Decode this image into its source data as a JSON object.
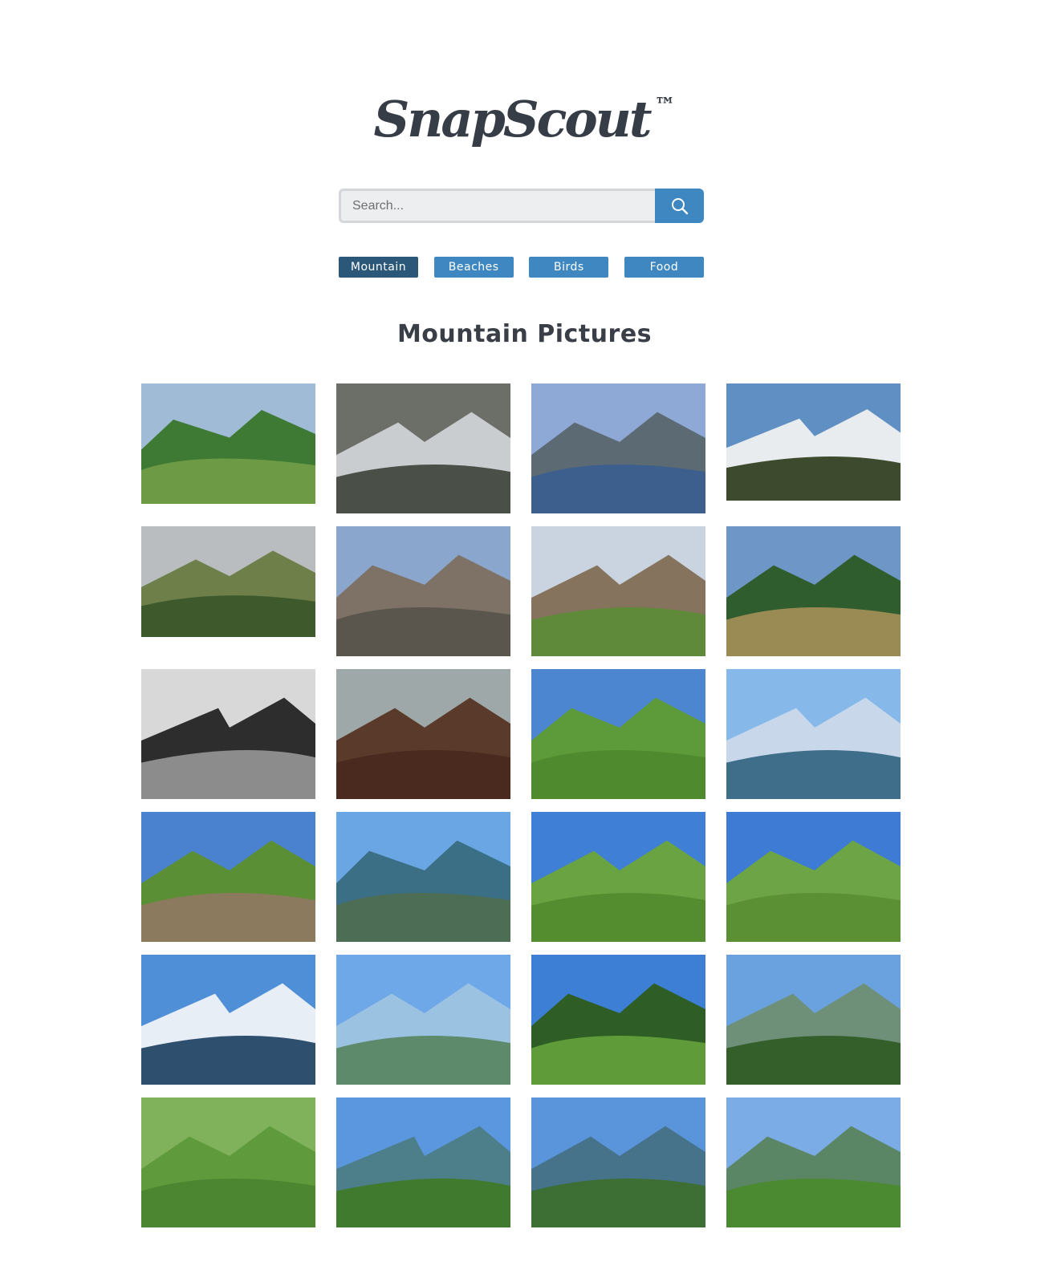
{
  "logo": {
    "text": "SnapScout",
    "tm": "™"
  },
  "search": {
    "placeholder": "Search...",
    "value": "",
    "icon": "search-icon"
  },
  "categories": [
    {
      "label": "Mountain",
      "active": true
    },
    {
      "label": "Beaches",
      "active": false
    },
    {
      "label": "Birds",
      "active": false
    },
    {
      "label": "Food",
      "active": false
    }
  ],
  "colors": {
    "accent": "#3e87c0",
    "active": "#2b5778",
    "text": "#3a3f47"
  },
  "gallery": {
    "heading": "Mountain Pictures",
    "photos": [
      {
        "name": "photo-monument-valley",
        "sky": "#9fbbd6",
        "mid": "#3f7a34",
        "ground": "#6d9b45",
        "h": 150
      },
      {
        "name": "photo-waterfall",
        "sky": "#6c6e68",
        "mid": "#c9cdd0",
        "ground": "#4a5048",
        "h": 162
      },
      {
        "name": "photo-lake-mountain",
        "sky": "#8ea9d6",
        "mid": "#5c6a74",
        "ground": "#3c5f8e",
        "h": 162
      },
      {
        "name": "photo-snow-volcano",
        "sky": "#5f8fc3",
        "mid": "#e8ecef",
        "ground": "#3d4a2d",
        "h": 146
      },
      {
        "name": "photo-valley-flowers",
        "sky": "#b9bdc0",
        "mid": "#6f7f4a",
        "ground": "#3e5a2c",
        "h": 138
      },
      {
        "name": "photo-rock-cliff",
        "sky": "#8aa6cc",
        "mid": "#7d7265",
        "ground": "#5a554d",
        "h": 162
      },
      {
        "name": "photo-wooden-barn",
        "sky": "#c9d4e0",
        "mid": "#86735e",
        "ground": "#5f8a3a",
        "h": 162
      },
      {
        "name": "photo-stone-barn",
        "sky": "#6e97c7",
        "mid": "#2f5d2d",
        "ground": "#9a8b55",
        "h": 162
      },
      {
        "name": "photo-bw-peaks",
        "sky": "#d8d8d8",
        "mid": "#2d2d2d",
        "ground": "#8c8c8c",
        "h": 162
      },
      {
        "name": "photo-loch-peak",
        "sky": "#9fa8a8",
        "mid": "#5a3a2a",
        "ground": "#4a2a1e",
        "h": 162
      },
      {
        "name": "photo-hillside-path",
        "sky": "#4c86d1",
        "mid": "#5d9a3a",
        "ground": "#4f8a2f",
        "h": 162
      },
      {
        "name": "photo-alps-panorama",
        "sky": "#86b9ea",
        "mid": "#c8d8ea",
        "ground": "#3f6e8a",
        "h": 162
      },
      {
        "name": "photo-rocky-trail",
        "sky": "#4a82d0",
        "mid": "#5b8f35",
        "ground": "#8b7a5e",
        "h": 162
      },
      {
        "name": "photo-valley-town",
        "sky": "#6aa6e4",
        "mid": "#3b6f86",
        "ground": "#4d6e55",
        "h": 162
      },
      {
        "name": "photo-green-ridge",
        "sky": "#3f7fd6",
        "mid": "#6aa342",
        "ground": "#548c30",
        "h": 162
      },
      {
        "name": "photo-grassy-slope",
        "sky": "#3d7bd4",
        "mid": "#6da445",
        "ground": "#5b9134",
        "h": 162
      },
      {
        "name": "photo-mont-blanc",
        "sky": "#4f8fd8",
        "mid": "#e8eef5",
        "ground": "#2e4f6e",
        "h": 162
      },
      {
        "name": "photo-hazy-plain",
        "sky": "#6fa8e8",
        "mid": "#9cc2e2",
        "ground": "#5d8a6a",
        "h": 162
      },
      {
        "name": "photo-fir-trail",
        "sky": "#3c7fd4",
        "mid": "#2e5e26",
        "ground": "#5f9b38",
        "h": 162
      },
      {
        "name": "photo-fir-overlook",
        "sky": "#6aa2e0",
        "mid": "#6e8f78",
        "ground": "#355f2a",
        "h": 162
      },
      {
        "name": "photo-white-flower",
        "sky": "#7fb25a",
        "mid": "#5f9a3c",
        "ground": "#4d8630",
        "h": 162
      },
      {
        "name": "photo-green-summit",
        "sky": "#5b97de",
        "mid": "#4d7f8a",
        "ground": "#3f7a2e",
        "h": 162
      },
      {
        "name": "photo-lake-valley",
        "sky": "#5a95dc",
        "mid": "#46728a",
        "ground": "#3d6f35",
        "h": 162
      },
      {
        "name": "photo-conical-hill",
        "sky": "#7bace6",
        "mid": "#5b8666",
        "ground": "#4c8a32",
        "h": 162
      }
    ]
  }
}
